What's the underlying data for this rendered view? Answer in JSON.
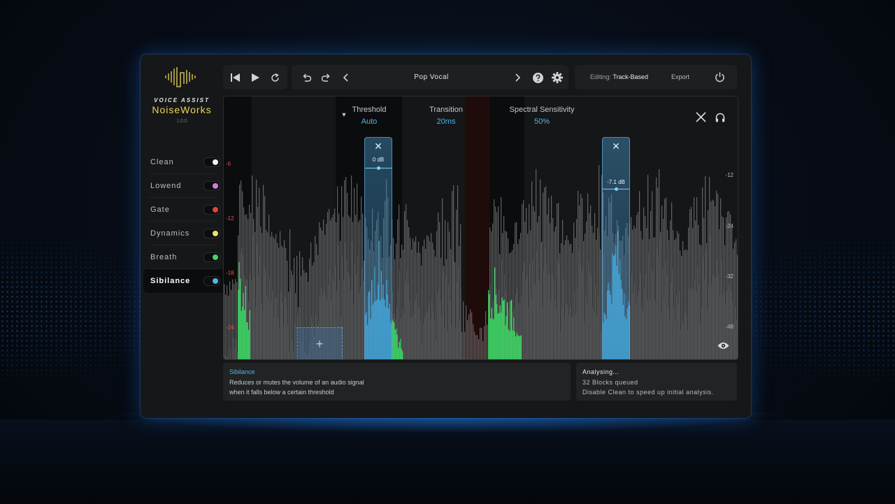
{
  "brand": {
    "tagline": "VOICE ASSIST",
    "name": "NoiseWorks",
    "version": "1.0.0"
  },
  "modules": [
    {
      "label": "Clean",
      "color": "#f2f2f2"
    },
    {
      "label": "Lowend",
      "color": "#d27fd8"
    },
    {
      "label": "Gate",
      "color": "#e0453f"
    },
    {
      "label": "Dynamics",
      "color": "#ece06a"
    },
    {
      "label": "Breath",
      "color": "#46d36a"
    },
    {
      "label": "Sibilance",
      "color": "#4fb6e8",
      "active": true
    }
  ],
  "toolbar": {
    "preset": "Pop Vocal",
    "editing_label": "Editing:",
    "editing_mode": "Track-Based",
    "export_label": "Export"
  },
  "params": {
    "threshold": {
      "label": "Threshold",
      "value": "Auto"
    },
    "transition": {
      "label": "Transition",
      "value": "20ms"
    },
    "sensitivity": {
      "label": "Spectral Sensitivity",
      "value": "50%"
    }
  },
  "scale_left": [
    "-6",
    "-12",
    "-18",
    "-24"
  ],
  "scale_right": [
    "-12",
    "-24",
    "-32",
    "-48"
  ],
  "bands": [
    {
      "gain": "0 dB"
    },
    {
      "gain": "-7.1 dB"
    }
  ],
  "description": {
    "title": "Sibilance",
    "line1": "Reduces or mutes the volume of an audio signal",
    "line2": "when it falls below a certain threshold"
  },
  "status": {
    "title": "Analysing...",
    "line1": "32 Blocks queued",
    "line2": "Disable Clean to speed up initial analysis."
  },
  "colors": {
    "accent": "#4fb6e8",
    "brand": "#e9d75a",
    "green": "#3dd363"
  }
}
